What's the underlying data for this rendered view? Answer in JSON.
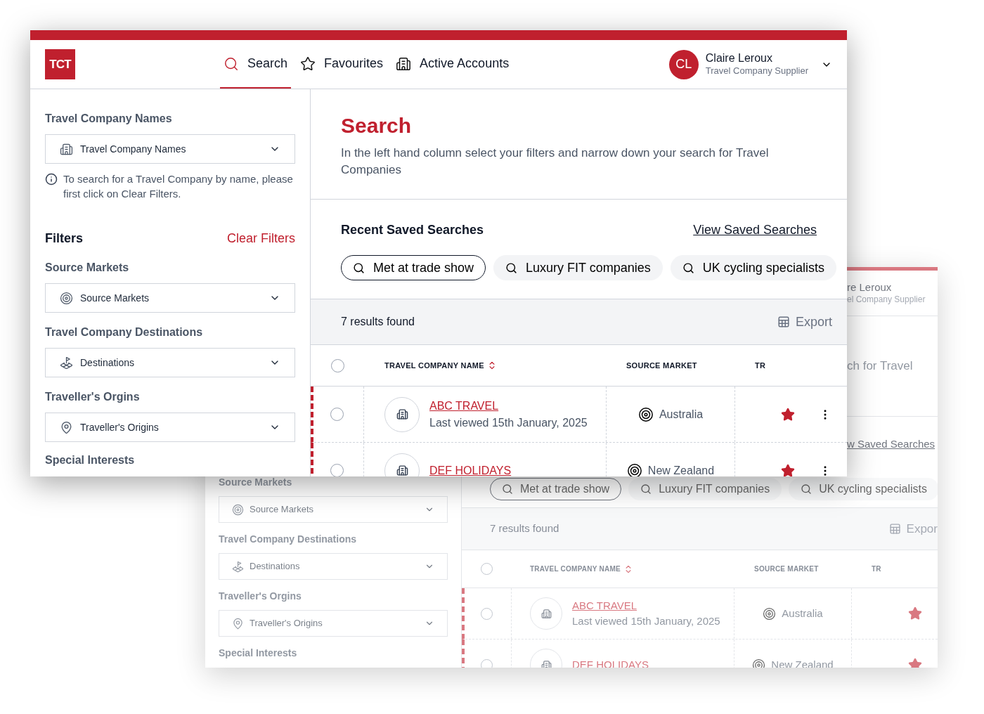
{
  "front": {
    "logo": "TCT",
    "nav": [
      {
        "label": "Search",
        "kind": "search",
        "selected": true
      },
      {
        "label": "Favourites",
        "kind": "star",
        "selected": false
      },
      {
        "label": "Active Accounts",
        "kind": "building",
        "selected": false
      }
    ],
    "user": {
      "initials": "CL",
      "name": "Claire Leroux",
      "role": "Travel Company Supplier"
    },
    "sidebar": {
      "name_filter": {
        "label": "Travel Company Names",
        "placeholder": "Travel Company Names",
        "kind": "building"
      },
      "hint": "To search for a Travel Company by name, please first click on Clear Filters.",
      "filters_title": "Filters",
      "clear": "Clear Filters",
      "filters": [
        {
          "label": "Source Markets",
          "placeholder": "Source Markets",
          "kind": "target"
        },
        {
          "label": "Travel Company Destinations",
          "placeholder": "Destinations",
          "kind": "plot"
        },
        {
          "label": "Traveller's Orgins",
          "placeholder": "Traveller's Origins",
          "kind": "pin"
        }
      ],
      "last_label": "Special Interests"
    },
    "main": {
      "title": "Search",
      "intro": "In the left hand column select your filters and narrow down your search for Travel Companies",
      "recent_title": "Recent Saved Searches",
      "view_link": "View Saved Searches",
      "chips": [
        {
          "label": "Met at trade show",
          "selected": true
        },
        {
          "label": "Luxury FIT companies",
          "selected": false
        },
        {
          "label": "UK cycling specialists",
          "selected": false
        }
      ],
      "results_count": "7 results found",
      "export": "Export",
      "select_all": {
        "checked": false
      },
      "columns": [
        {
          "label": "TRAVEL COMPANY NAME",
          "sortable": true
        },
        {
          "label": "SOURCE MARKET",
          "sortable": false
        },
        {
          "label": "TR",
          "sortable": false
        }
      ],
      "rows": [
        {
          "name": "ABC TRAVEL",
          "last_viewed": "Last viewed 15th January, 2025",
          "market": "Australia",
          "favourite": true,
          "checked": false
        },
        {
          "name": "DEF HOLIDAYS",
          "market": "New Zealand",
          "favourite": true,
          "checked": false
        }
      ]
    }
  },
  "back": {
    "user_name": "re Leroux",
    "user_role": "el Company Supplier",
    "intro": "ch for Travel",
    "view_link": "w Saved Searches",
    "chips": [
      {
        "label": "Met at trade show",
        "selected": true
      },
      {
        "label": "Luxury FIT companies",
        "selected": false
      },
      {
        "label": "UK cycling specialists",
        "selected": false
      }
    ],
    "filters": [
      {
        "label": "Source Markets",
        "placeholder": "Source Markets",
        "kind": "target"
      },
      {
        "label": "Travel Company Destinations",
        "placeholder": "Destinations",
        "kind": "plot"
      },
      {
        "label": "Traveller's Orgins",
        "placeholder": "Traveller's Origins",
        "kind": "pin"
      }
    ],
    "last_label": "Special Interests",
    "results_count": "7 results found",
    "export": "Expor",
    "select_all": {
      "checked": false
    },
    "columns": [
      {
        "label": "TRAVEL COMPANY NAME",
        "sortable": true
      },
      {
        "label": "SOURCE MARKET",
        "sortable": false
      },
      {
        "label": "TR",
        "sortable": false
      }
    ],
    "rows": [
      {
        "name": "ABC TRAVEL",
        "last_viewed": "Last viewed 15th January, 2025",
        "market": "Australia",
        "favourite": true,
        "checked": false
      },
      {
        "name": "DEF HOLIDAYS",
        "market": "New Zealand",
        "favourite": true,
        "checked": false
      }
    ]
  }
}
